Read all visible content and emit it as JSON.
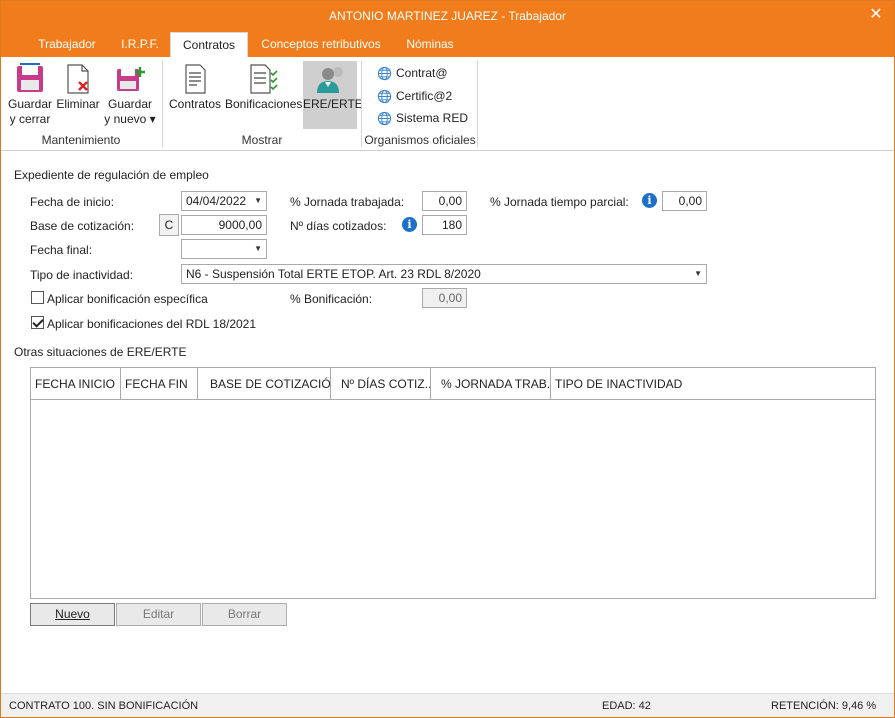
{
  "window": {
    "title": "ANTONIO MARTINEZ JUAREZ - Trabajador"
  },
  "tabs": [
    {
      "label": "Trabajador"
    },
    {
      "label": "I.R.P.F."
    },
    {
      "label": "Contratos"
    },
    {
      "label": "Conceptos retributivos"
    },
    {
      "label": "Nóminas"
    }
  ],
  "ribbon": {
    "mantenimiento": {
      "label": "Mantenimiento",
      "guardar_cerrar": {
        "line1": "Guardar",
        "line2": "y cerrar"
      },
      "eliminar": "Eliminar",
      "guardar_nuevo": {
        "line1": "Guardar",
        "line2": "y nuevo ▾"
      }
    },
    "mostrar": {
      "label": "Mostrar",
      "contratos": "Contratos",
      "bonificaciones": "Bonificaciones",
      "ere_erte": "ERE/ERTE"
    },
    "organismos": {
      "label": "Organismos oficiales",
      "contrata": "Contrat@",
      "certifica": "Certific@2",
      "sistema_red": "Sistema RED"
    }
  },
  "expediente": {
    "section_title": "Expediente de regulación de empleo",
    "fecha_inicio_label": "Fecha de inicio:",
    "fecha_inicio_value": "04/04/2022",
    "jornada_trabajada_label": "% Jornada trabajada:",
    "jornada_trabajada_value": "0,00",
    "jornada_parcial_label": "% Jornada tiempo parcial:",
    "jornada_parcial_value": "0,00",
    "base_cotizacion_label": "Base de cotización:",
    "base_cotizacion_btn": "C",
    "base_cotizacion_value": "9000,00",
    "dias_cotizados_label": "Nº días cotizados:",
    "dias_cotizados_value": "180",
    "fecha_final_label": "Fecha final:",
    "fecha_final_value": "",
    "tipo_inactividad_label": "Tipo de inactividad:",
    "tipo_inactividad_value": "N6 - Suspensión Total ERTE ETOP. Art. 23 RDL 8/2020",
    "bonif_especifica_label": "Aplicar bonificación específica",
    "bonif_especifica_checked": false,
    "porc_bonificacion_label": "% Bonificación:",
    "porc_bonificacion_value": "0,00",
    "bonif_rdl_label": "Aplicar bonificaciones del RDL 18/2021",
    "bonif_rdl_checked": true
  },
  "otras": {
    "section_title": "Otras situaciones de ERE/ERTE",
    "columns": [
      "FECHA INICIO",
      "FECHA FIN",
      "BASE DE COTIZACIÓN",
      "Nº DÍAS COTIZ...",
      "% JORNADA TRAB...",
      "TIPO DE INACTIVIDAD"
    ],
    "rows": [],
    "buttons": {
      "nuevo": "Nuevo",
      "editar": "Editar",
      "borrar": "Borrar"
    }
  },
  "status": {
    "contrato": "CONTRATO 100.  SIN BONIFICACIÓN",
    "edad": "EDAD: 42",
    "retencion": "RETENCIÓN: 9,46 %"
  },
  "colors": {
    "accent": "#f07c1b",
    "info": "#1e6fc8"
  }
}
